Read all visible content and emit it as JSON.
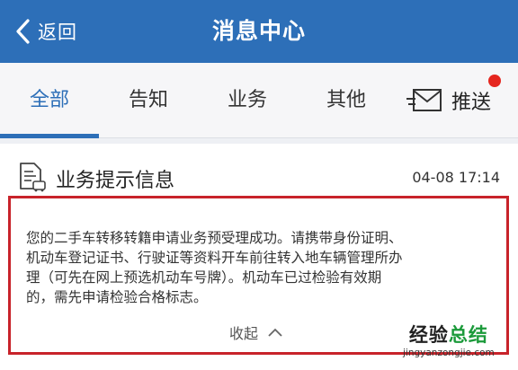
{
  "header": {
    "back_label": "返回",
    "title": "消息中心"
  },
  "tabs": [
    {
      "label": "全部",
      "active": true
    },
    {
      "label": "告知",
      "active": false
    },
    {
      "label": "业务",
      "active": false
    },
    {
      "label": "其他",
      "active": false
    }
  ],
  "push": {
    "label": "推送",
    "has_unread_dot": true
  },
  "message": {
    "title": "业务提示信息",
    "time": "04-08 17:14",
    "body_lines": [
      "您的二手车转移转籍申请业务预受理成功。请携带身份证明、",
      "机动车登记证书、行驶证等资料开车前往转入地车辆管理所办",
      "理（可先在网上预选机动车号牌）。机动车已过检验有效期",
      "的，需先申请检验合格标志。"
    ],
    "collapse_label": "收起"
  },
  "watermark": {
    "title_part1": "经验",
    "title_part2": "总结",
    "url": "jingyanzongjie.com"
  },
  "colors": {
    "header_blue": "#2d6fb8",
    "highlight_red": "#c8232a",
    "badge_red": "#e5261f",
    "watermark_green": "#1b9a3a"
  }
}
